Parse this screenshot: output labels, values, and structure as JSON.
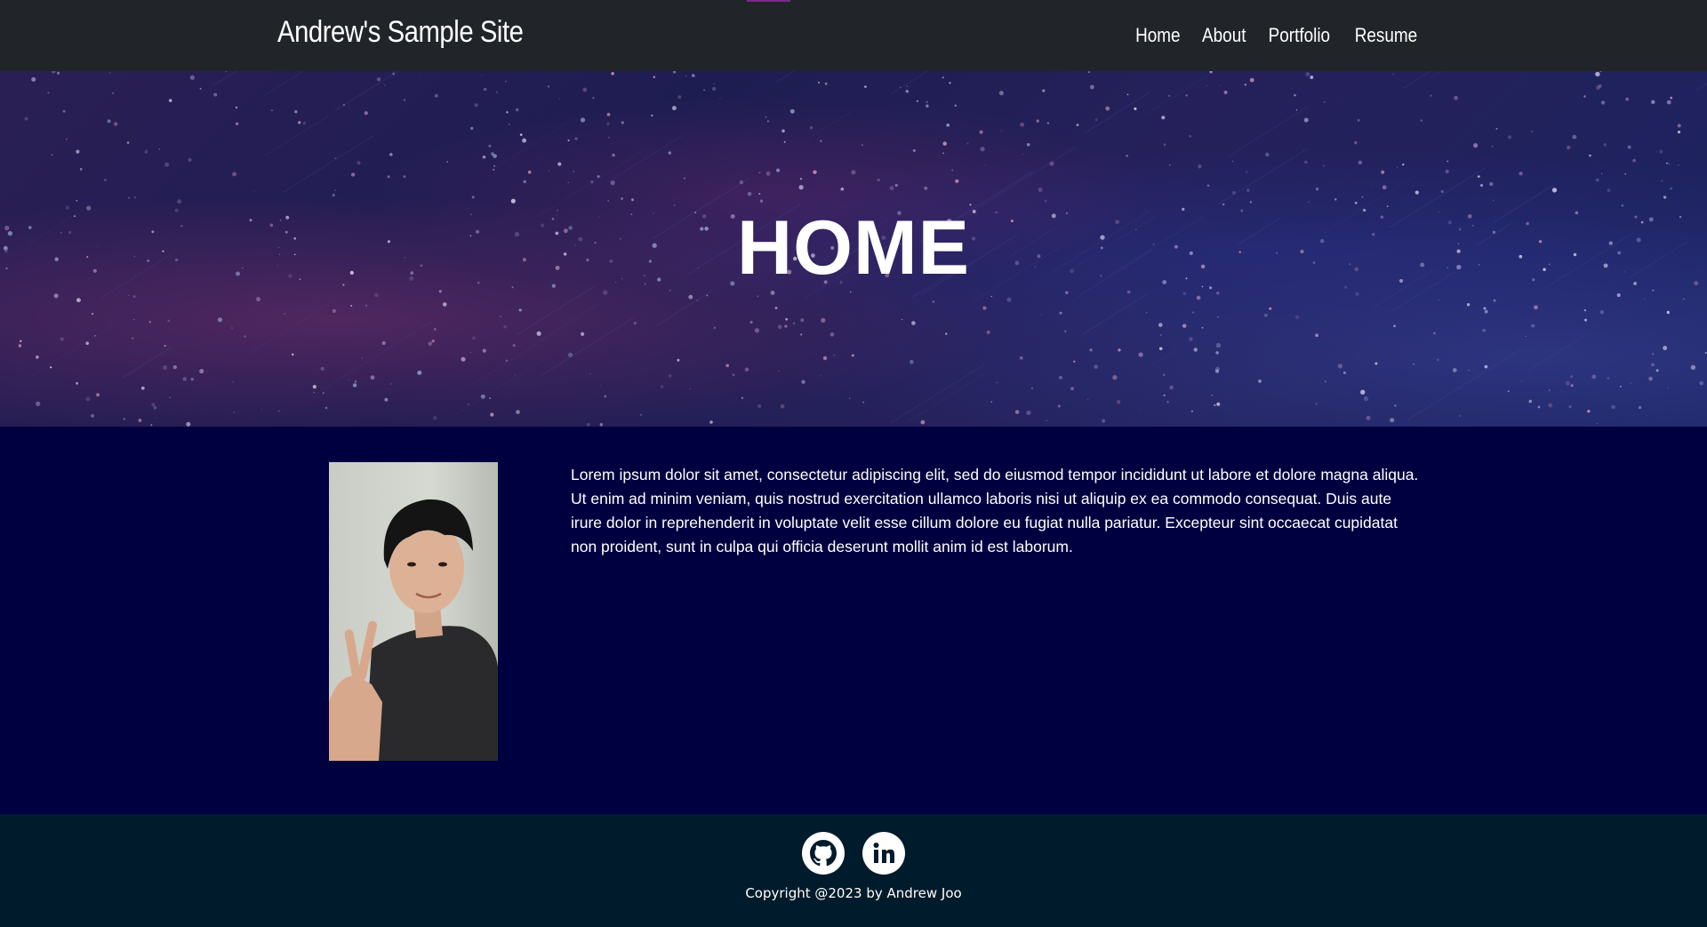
{
  "header": {
    "brand": "Andrew's Sample Site",
    "nav": [
      {
        "label": "Home"
      },
      {
        "label": "About"
      },
      {
        "label": "Portfolio"
      },
      {
        "label": "Resume"
      }
    ]
  },
  "hero": {
    "title": "HOME"
  },
  "main": {
    "intro": "Lorem ipsum dolor sit amet, consectetur adipiscing elit, sed do eiusmod tempor incididunt ut labore et dolore magna aliqua. Ut enim ad minim veniam, quis nostrud exercitation ullamco laboris nisi ut aliquip ex ea commodo consequat. Duis aute irure dolor in reprehenderit in voluptate velit esse cillum dolore eu fugiat nulla pariatur. Excepteur sint occaecat cupidatat non proident, sunt in culpa qui officia deserunt mollit anim id est laborum.",
    "photo_icon": "profile-photo"
  },
  "footer": {
    "social": [
      {
        "icon": "github-icon"
      },
      {
        "icon": "linkedin-icon"
      }
    ],
    "copyright": "Copyright @2023 by Andrew Joo"
  },
  "colors": {
    "navbar": "#212529",
    "main_bg": "#000040",
    "footer_bg": "#001b2b",
    "text": "#ffffff"
  }
}
